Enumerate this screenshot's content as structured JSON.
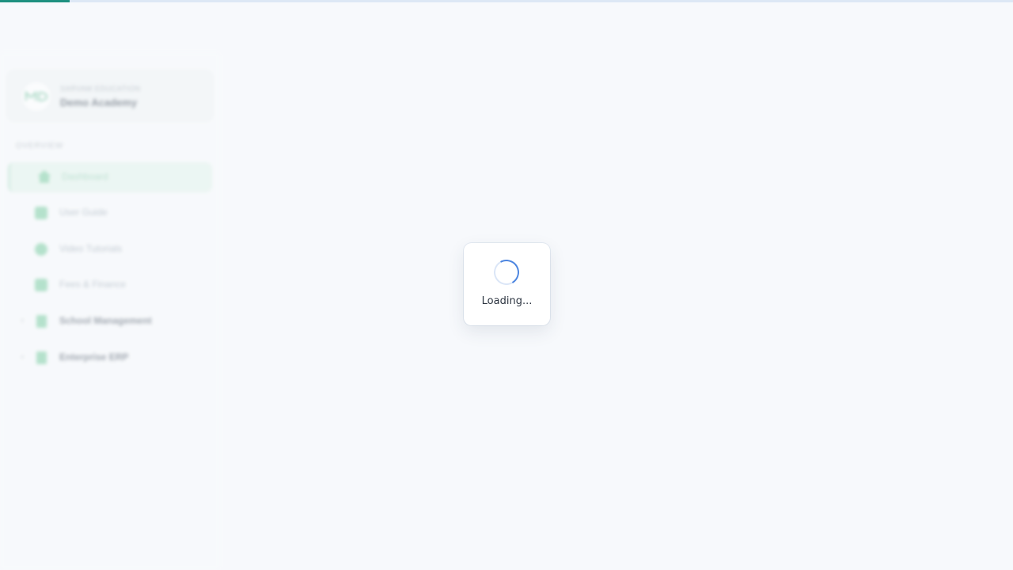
{
  "progress": {
    "fraction": 0.069,
    "color": "#1e9080"
  },
  "sidebar": {
    "school": {
      "caption": "SARVAM EDUCATION",
      "name": "Demo Academy",
      "logo_text": "MD"
    },
    "section_label": "OVERVIEW",
    "items": [
      {
        "label": "Dashboard",
        "icon": "home-icon",
        "active": true
      },
      {
        "label": "User Guide",
        "icon": "book-icon",
        "active": false
      },
      {
        "label": "Video Tutorials",
        "icon": "play-circle-icon",
        "active": false
      },
      {
        "label": "Fees & Finance",
        "icon": "card-icon",
        "active": false
      },
      {
        "label": "School Management",
        "icon": "building-icon",
        "expandable": true
      },
      {
        "label": "Enterprise ERP",
        "icon": "building-icon",
        "expandable": true
      }
    ],
    "chevron": "›"
  },
  "loading": {
    "text": "Loading..."
  },
  "colors": {
    "accent": "#1e9080",
    "spinner": "#4d86e0",
    "active_bg": "#e3f4ec",
    "icon_green": "#7fcfa5"
  }
}
